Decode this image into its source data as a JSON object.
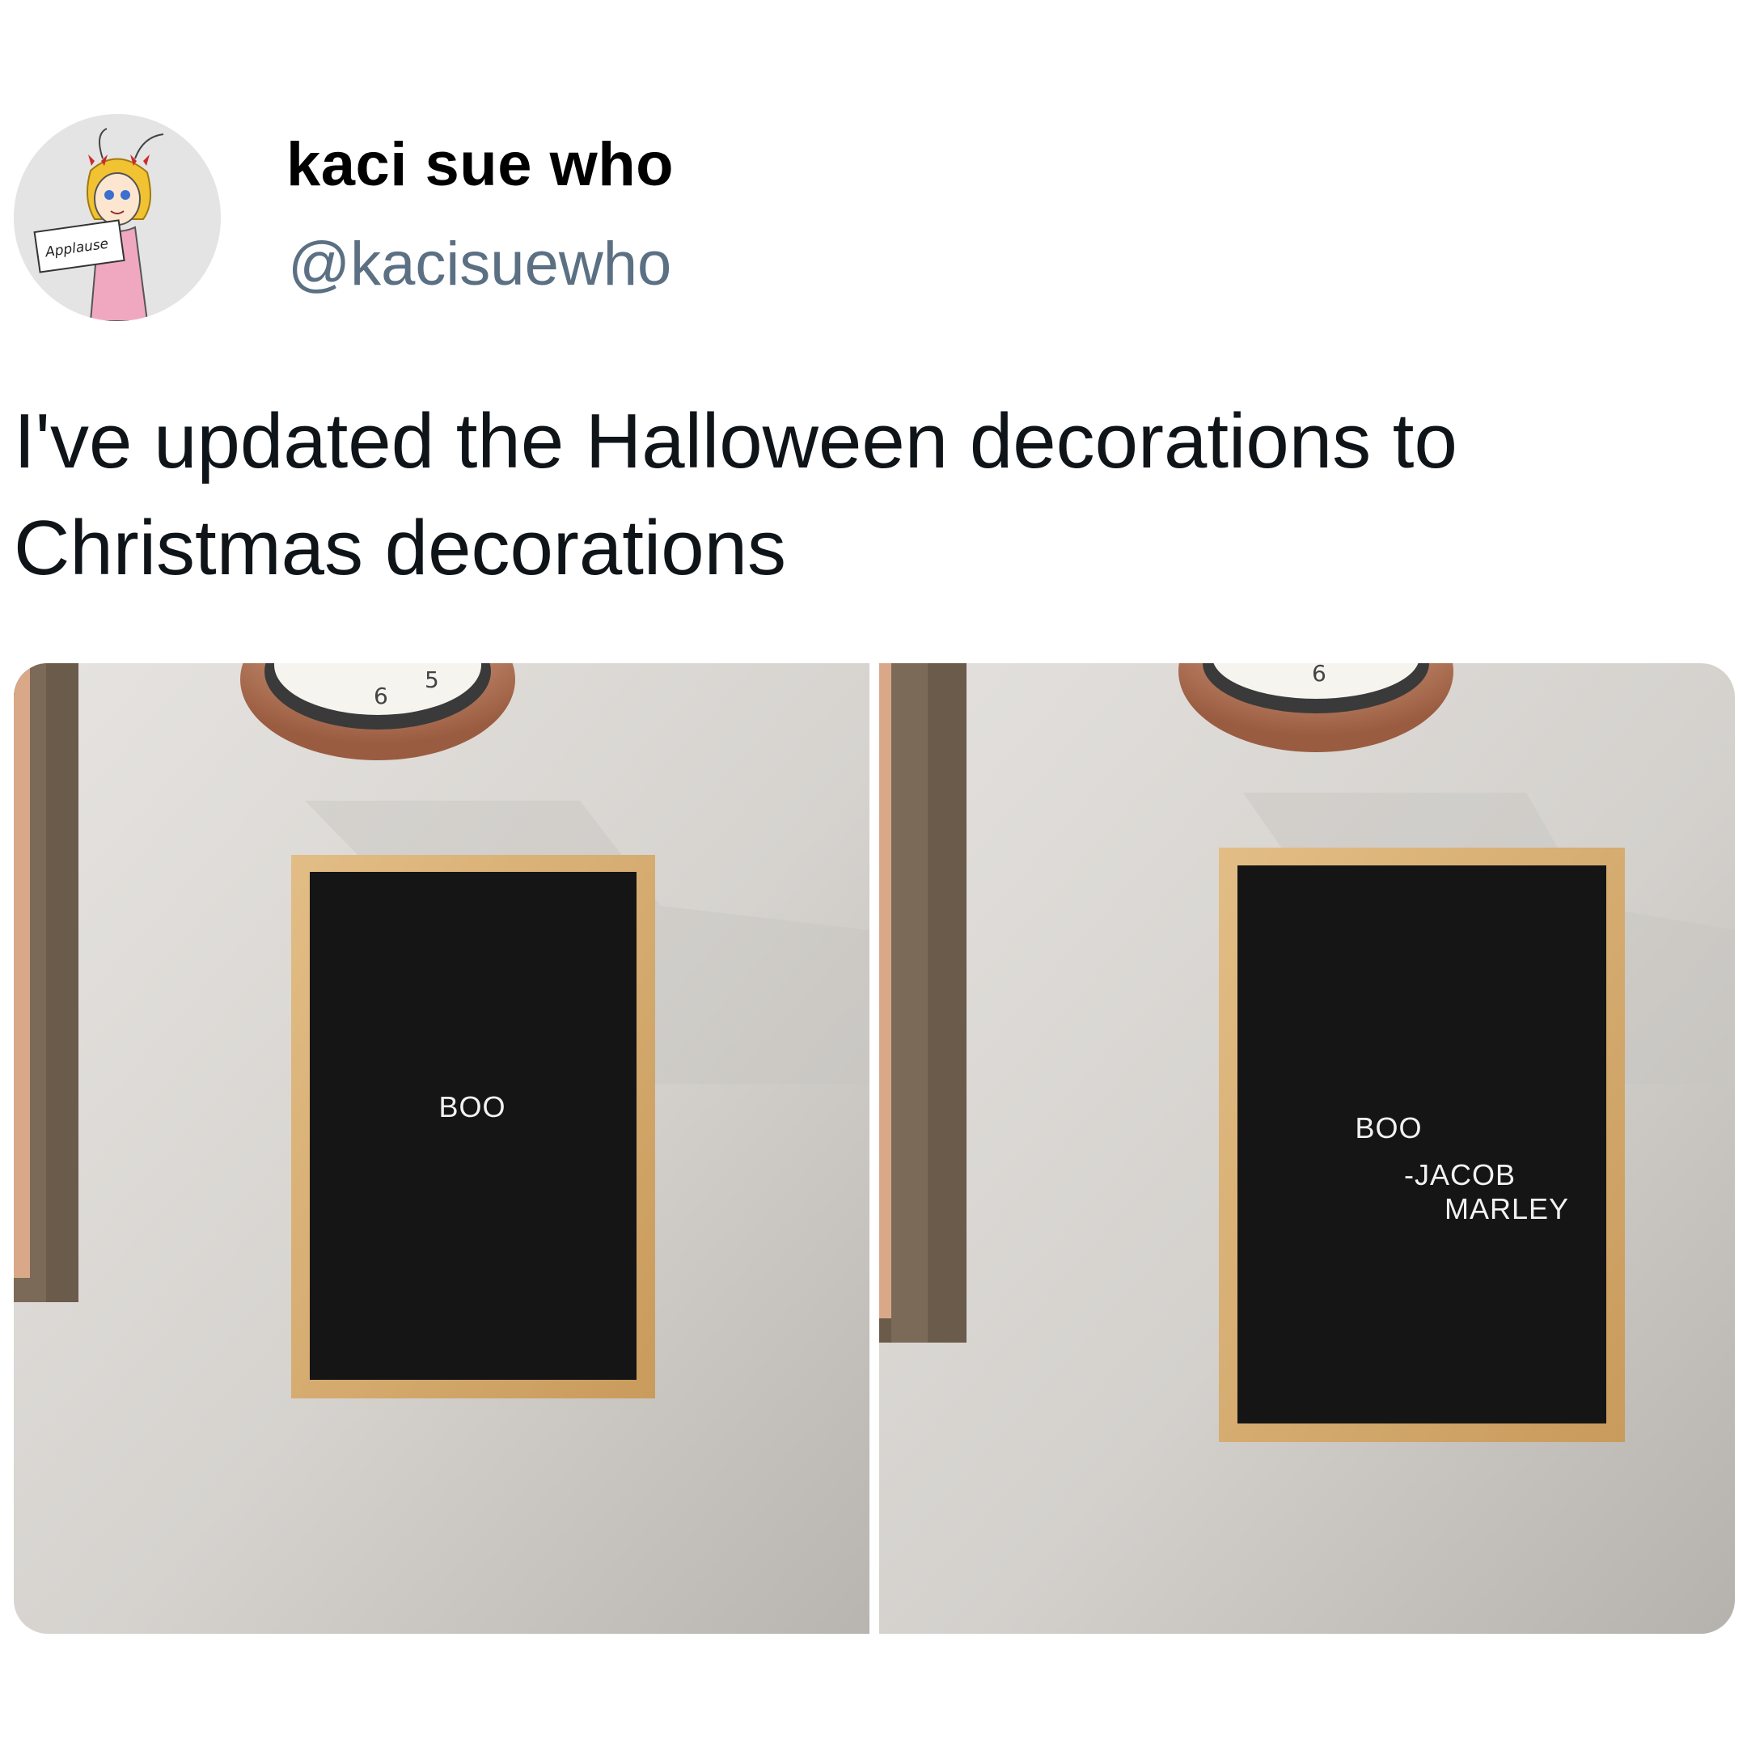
{
  "author": {
    "display_name": "kaci sue who",
    "handle": "@kacisuewho",
    "avatar_sign_text": "Applause"
  },
  "tweet": {
    "text": "I've updated the Halloween decorations to Christmas decorations"
  },
  "media": {
    "photos": [
      {
        "clock_numbers": [
          "6",
          "5"
        ],
        "sign_lines": [
          "BOO"
        ]
      },
      {
        "clock_numbers": [
          "6"
        ],
        "sign_lines": [
          "BOO",
          "-JACOB",
          "MARLEY"
        ]
      }
    ]
  },
  "colors": {
    "handle": "#5b7083",
    "text": "#0f1419",
    "wall": "#d9d6d2",
    "letterboard": "#151515",
    "oak_frame": "#d8b27a",
    "clock_copper": "#b87a5c"
  }
}
